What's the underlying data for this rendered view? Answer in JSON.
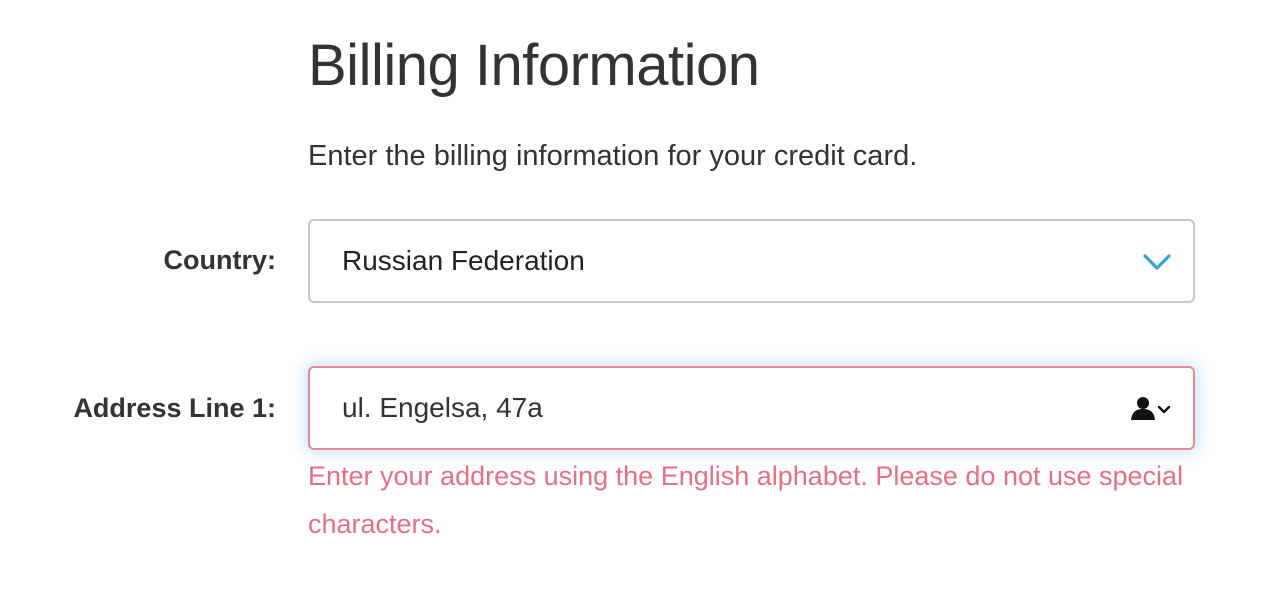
{
  "page": {
    "title": "Billing Information",
    "subtitle": "Enter the billing information for your credit card."
  },
  "form": {
    "country": {
      "label": "Country:",
      "value": "Russian Federation",
      "icon": "chevron-down-icon"
    },
    "address_line_1": {
      "label": "Address Line 1:",
      "value": "ul. Engelsa, 47a",
      "icon": "contact-card-icon",
      "error": "Enter your address using the English alphabet. Please do not use special characters."
    }
  },
  "colors": {
    "accent": "#3aa0d8",
    "error": "#e57084",
    "error_border": "#e58a98"
  }
}
